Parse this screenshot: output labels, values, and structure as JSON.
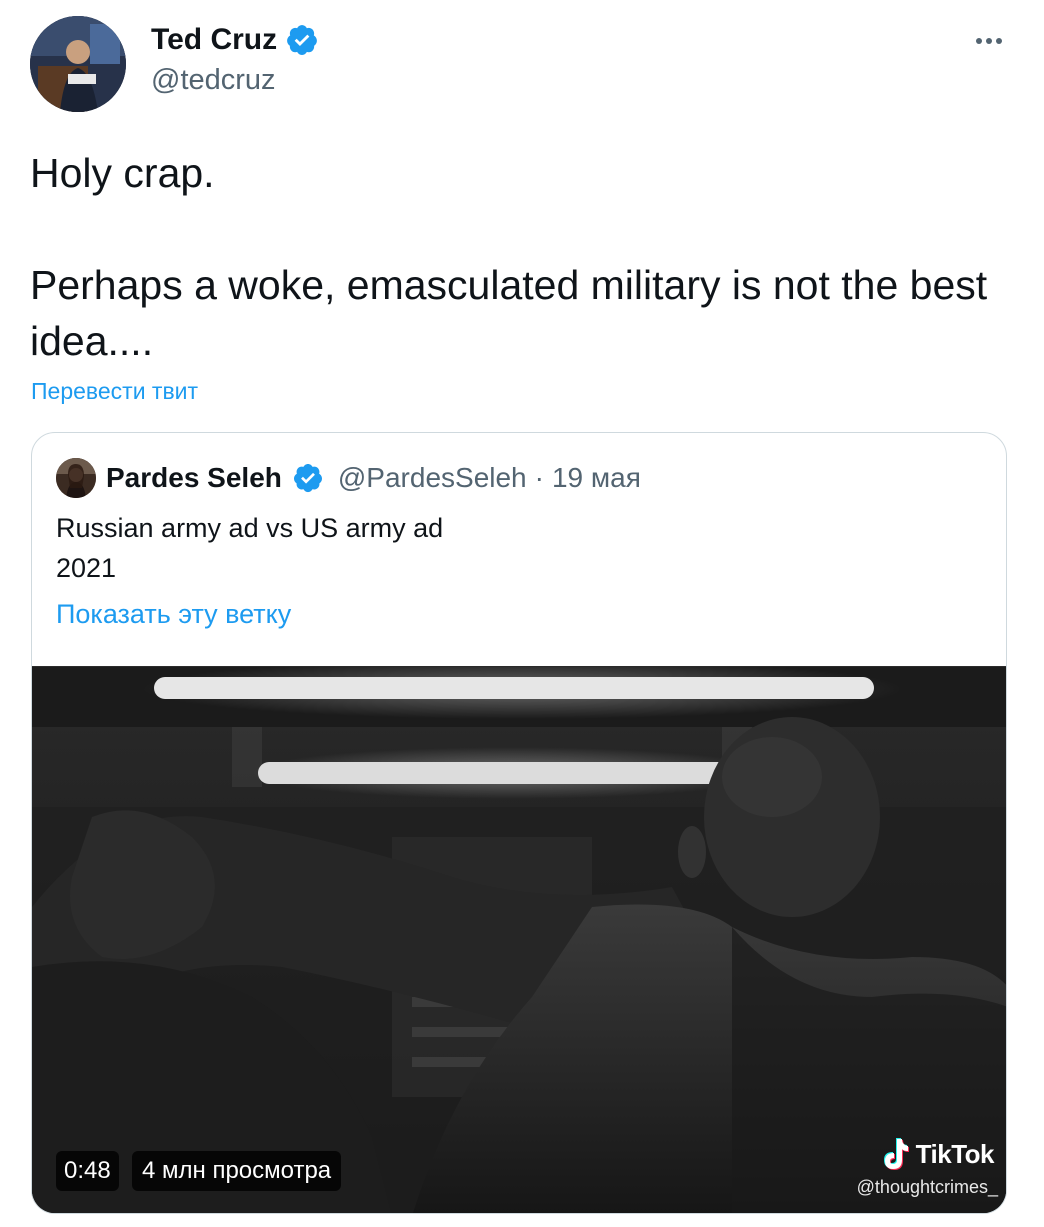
{
  "author": {
    "name": "Ted Cruz",
    "handle": "@tedcruz"
  },
  "tweet": {
    "line1": "Holy crap.",
    "line2": "Perhaps a woke, emasculated military is not the best idea....",
    "translate_label": "Перевести твит"
  },
  "quote": {
    "name": "Pardes Seleh",
    "handle": "@PardesSeleh",
    "separator": "·",
    "date": "19 мая",
    "text_line1": "Russian army ad vs US army ad",
    "text_line2": "2021",
    "show_thread_label": "Показать эту ветку",
    "media": {
      "duration": "0:48",
      "views": "4 млн просмотра",
      "watermark_brand": "TikTok",
      "watermark_user": "@thoughtcrimes_"
    }
  },
  "icons": {
    "verified": "verified-badge-icon",
    "more": "more-options-icon",
    "tiktok": "tiktok-logo-icon"
  },
  "colors": {
    "accent": "#1d9bf0",
    "text_primary": "#0f1419",
    "text_secondary": "#536471",
    "border": "#cfd9de"
  }
}
